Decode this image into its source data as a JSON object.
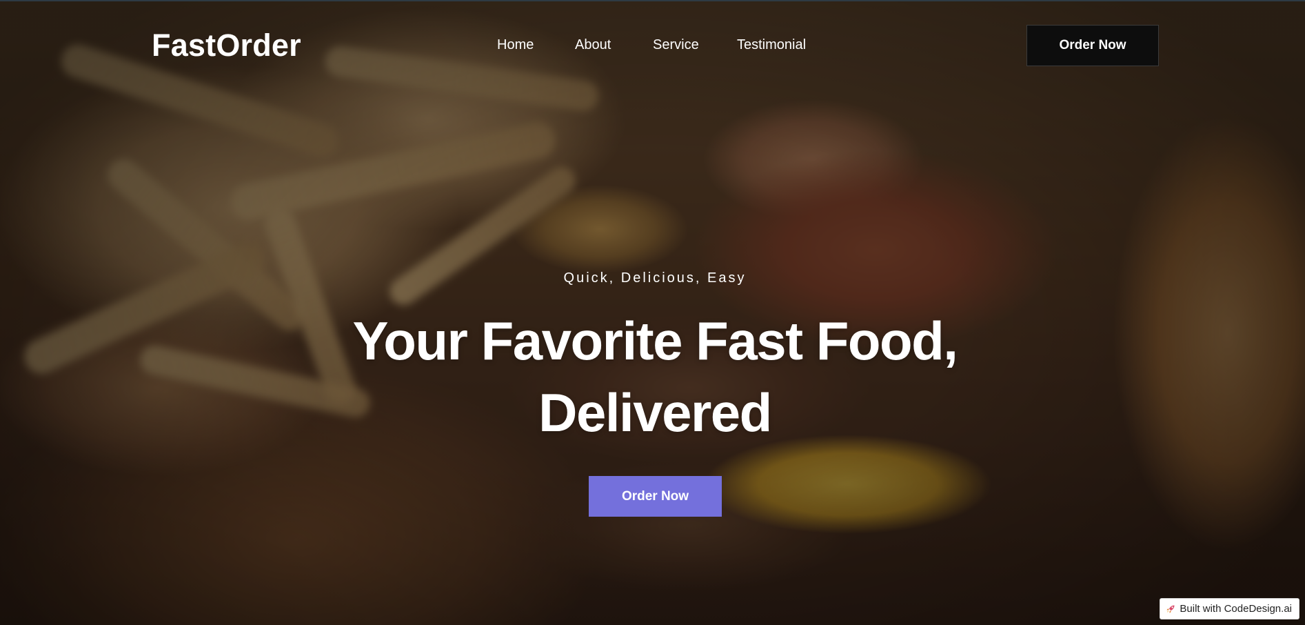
{
  "brand": {
    "logo_text": "FastOrder"
  },
  "nav": {
    "links": [
      {
        "label": "Home"
      },
      {
        "label": "About"
      },
      {
        "label": "Service"
      },
      {
        "label": "Testimonial"
      }
    ],
    "cta_label": "Order Now"
  },
  "hero": {
    "tagline": "Quick, Delicious, Easy",
    "headline_line1": "Your Favorite Fast Food,",
    "headline_line2": "Delivered",
    "cta_label": "Order Now",
    "background_image": "burger-and-fries-photo"
  },
  "badge": {
    "icon": "rocket-icon",
    "text": "Built with CodeDesign.ai"
  },
  "colors": {
    "primary_button": "#7470dc",
    "nav_button": "#0d0d0d",
    "text": "#ffffff"
  }
}
